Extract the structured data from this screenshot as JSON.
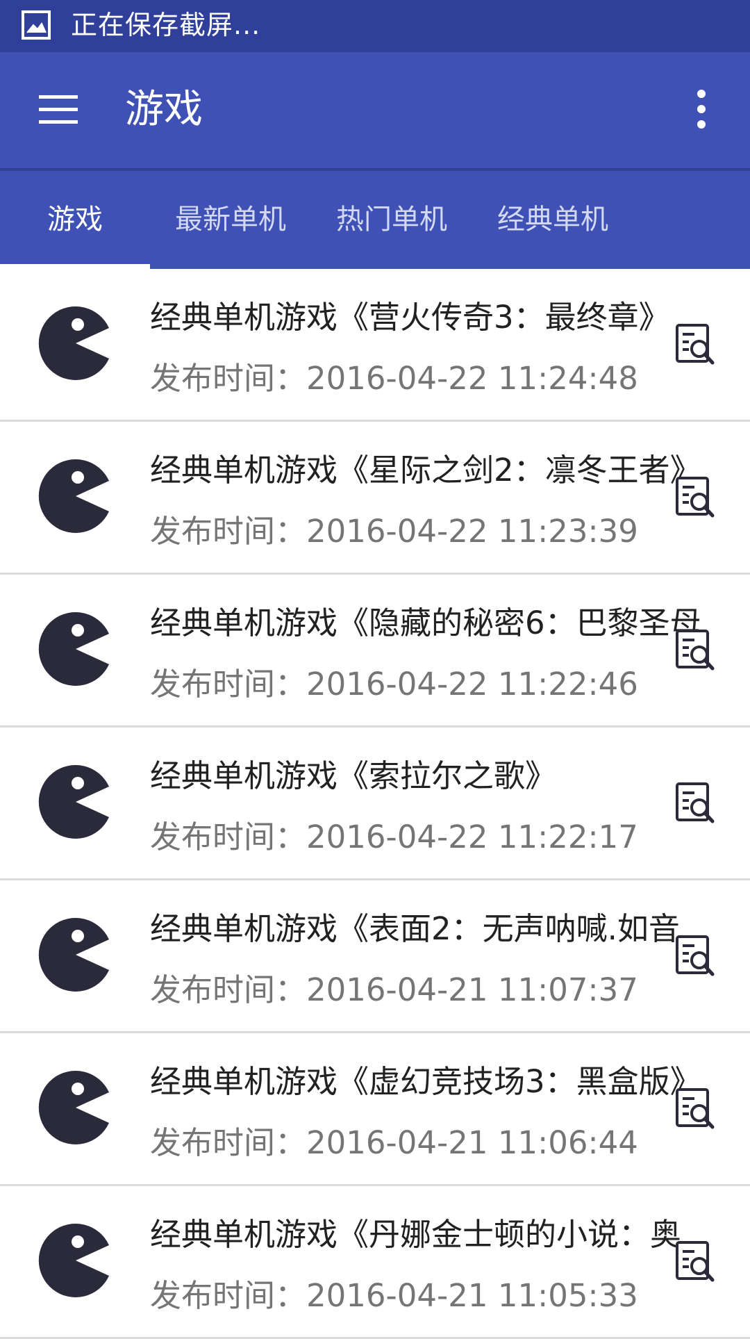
{
  "status_bar": {
    "text": "正在保存截屏...",
    "icon": "image-icon"
  },
  "app_bar": {
    "title": "游戏",
    "menu_icon": "hamburger-menu-icon",
    "overflow_icon": "more-vert-icon"
  },
  "tabs": [
    {
      "label": "游戏",
      "active": true
    },
    {
      "label": "最新单机",
      "active": false
    },
    {
      "label": "热门单机",
      "active": false
    },
    {
      "label": "经典单机",
      "active": false
    }
  ],
  "items": [
    {
      "title": "经典单机游戏《营火传奇3：最终章》",
      "date": "发布时间：2016-04-22 11:24:48"
    },
    {
      "title": "经典单机游戏《星际之剑2：凛冬王者》",
      "date": "发布时间：2016-04-22 11:23:39"
    },
    {
      "title": "经典单机游戏《隐藏的秘密6：巴黎圣母",
      "date": "发布时间：2016-04-22 11:22:46"
    },
    {
      "title": "经典单机游戏《索拉尔之歌》",
      "date": "发布时间：2016-04-22 11:22:17"
    },
    {
      "title": "经典单机游戏《表面2：无声呐喊.如音",
      "date": "发布时间：2016-04-21 11:07:37"
    },
    {
      "title": "经典单机游戏《虚幻竞技场3：黑盒版》",
      "date": "发布时间：2016-04-21 11:06:44"
    },
    {
      "title": "经典单机游戏《丹娜金士顿的小说：奥",
      "date": "发布时间：2016-04-21 11:05:33"
    }
  ],
  "colors": {
    "status_bar": "#30409a",
    "primary": "#3f51b5",
    "icon_dark": "#2a2a3a",
    "divider": "#dadada"
  }
}
